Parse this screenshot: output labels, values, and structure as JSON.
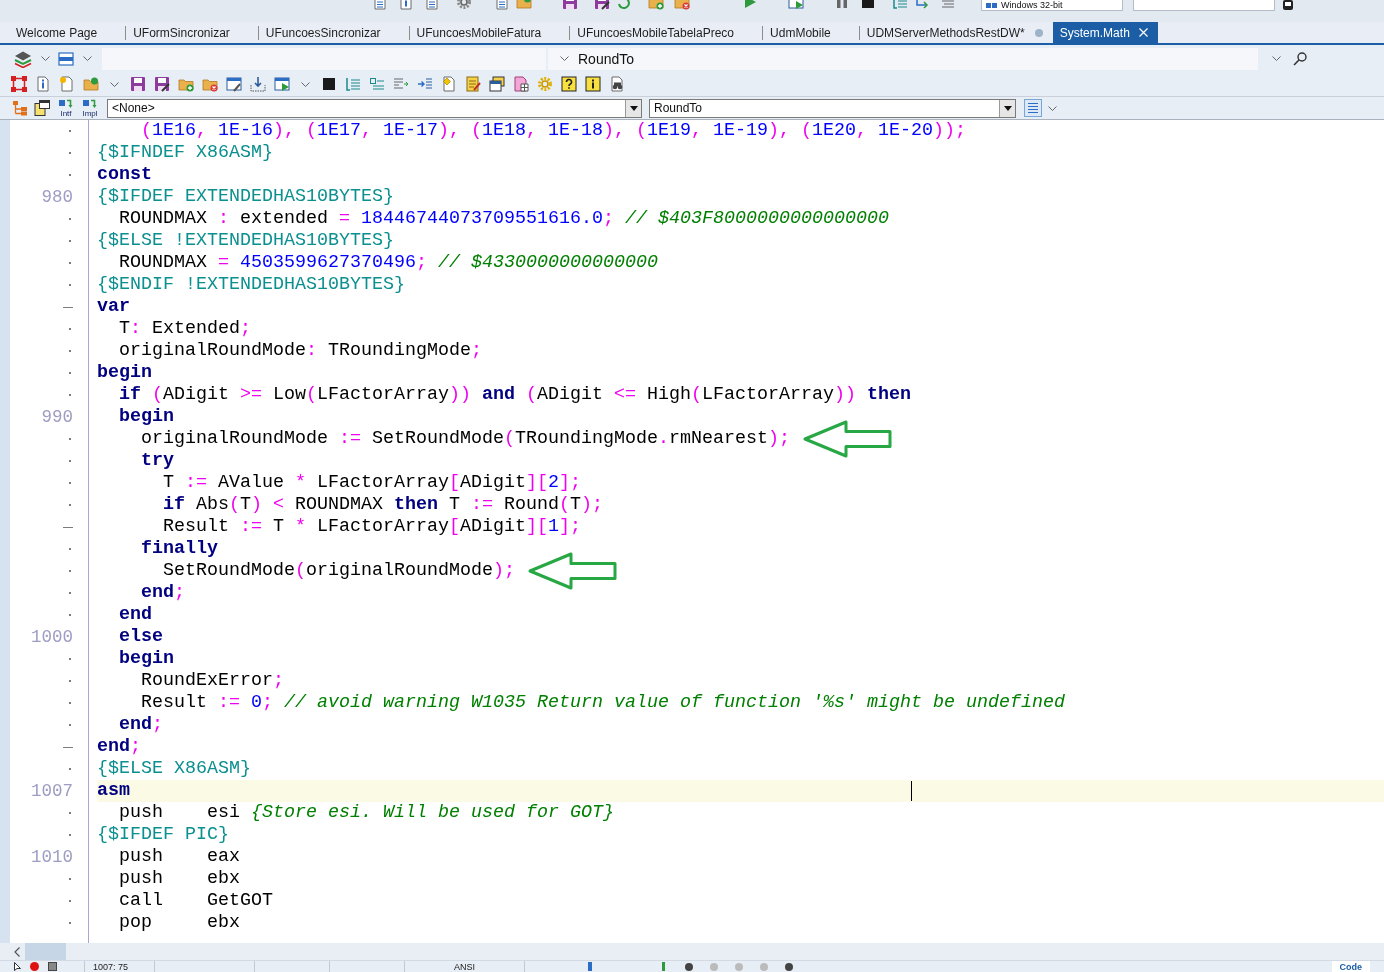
{
  "top_toolbar": {
    "platform": "Windows 32-bit"
  },
  "tabs": [
    {
      "label": "Welcome Page",
      "selected": false,
      "dot": false
    },
    {
      "label": "UFormSincronizar",
      "selected": false,
      "dot": false
    },
    {
      "label": "UFuncoesSincronizar",
      "selected": false,
      "dot": false
    },
    {
      "label": "UFuncoesMobileFatura",
      "selected": false,
      "dot": false
    },
    {
      "label": "UFuncoesMobileTabelaPreco",
      "selected": false,
      "dot": false
    },
    {
      "label": "UdmMobile",
      "selected": false,
      "dot": false
    },
    {
      "label": "UDMServerMethodsRestDW*",
      "selected": false,
      "dot": true
    },
    {
      "label": "System.Math",
      "selected": true,
      "dot": false
    }
  ],
  "navigation_bar": {
    "method": "RoundTo"
  },
  "symbol_bar": {
    "buttons": [
      {
        "label": "Intf"
      },
      {
        "label": "Impl"
      }
    ],
    "scope": "<None>",
    "method": "RoundTo"
  },
  "editor": {
    "lines": [
      {
        "gutter": {
          "kind": "dot"
        },
        "current": false,
        "arrow": false,
        "tokens": [
          {
            "kind": "symbol",
            "text": "    ("
          },
          {
            "kind": "number",
            "text": "1E16"
          },
          {
            "kind": "symbol",
            "text": ","
          },
          {
            "kind": "number",
            "text": " 1E-16"
          },
          {
            "kind": "symbol",
            "text": "), ("
          },
          {
            "kind": "number",
            "text": "1E17"
          },
          {
            "kind": "symbol",
            "text": ","
          },
          {
            "kind": "number",
            "text": " 1E-17"
          },
          {
            "kind": "symbol",
            "text": "), ("
          },
          {
            "kind": "number",
            "text": "1E18"
          },
          {
            "kind": "symbol",
            "text": ","
          },
          {
            "kind": "number",
            "text": " 1E-18"
          },
          {
            "kind": "symbol",
            "text": "), ("
          },
          {
            "kind": "number",
            "text": "1E19"
          },
          {
            "kind": "symbol",
            "text": ","
          },
          {
            "kind": "number",
            "text": " 1E-19"
          },
          {
            "kind": "symbol",
            "text": "), ("
          },
          {
            "kind": "number",
            "text": "1E20"
          },
          {
            "kind": "symbol",
            "text": ","
          },
          {
            "kind": "number",
            "text": " 1E-20"
          },
          {
            "kind": "symbol",
            "text": "));"
          }
        ]
      },
      {
        "gutter": {
          "kind": "dot"
        },
        "current": false,
        "arrow": false,
        "tokens": [
          {
            "kind": "directive",
            "text": "{$IFNDEF X86ASM}"
          }
        ]
      },
      {
        "gutter": {
          "kind": "dot"
        },
        "current": false,
        "arrow": false,
        "tokens": [
          {
            "kind": "keyword",
            "text": "const"
          }
        ]
      },
      {
        "gutter": {
          "kind": "number",
          "text": "980"
        },
        "current": false,
        "arrow": false,
        "tokens": [
          {
            "kind": "directive",
            "text": "{$IFDEF EXTENDEDHAS10BYTES}"
          }
        ]
      },
      {
        "gutter": {
          "kind": "dot"
        },
        "current": false,
        "arrow": false,
        "tokens": [
          {
            "kind": "plain",
            "text": "  ROUNDMAX "
          },
          {
            "kind": "symbol",
            "text": ":"
          },
          {
            "kind": "plain",
            "text": " extended "
          },
          {
            "kind": "symbol",
            "text": "="
          },
          {
            "kind": "number",
            "text": " 18446744073709551616.0"
          },
          {
            "kind": "symbol",
            "text": ";"
          },
          {
            "kind": "comment",
            "text": " // $403F8000000000000000"
          }
        ]
      },
      {
        "gutter": {
          "kind": "dot"
        },
        "current": false,
        "arrow": false,
        "tokens": [
          {
            "kind": "directive",
            "text": "{$ELSE !EXTENDEDHAS10BYTES}"
          }
        ]
      },
      {
        "gutter": {
          "kind": "dot"
        },
        "current": false,
        "arrow": false,
        "tokens": [
          {
            "kind": "plain",
            "text": "  ROUNDMAX "
          },
          {
            "kind": "symbol",
            "text": "="
          },
          {
            "kind": "number",
            "text": " 4503599627370496"
          },
          {
            "kind": "symbol",
            "text": ";"
          },
          {
            "kind": "comment",
            "text": " // $4330000000000000"
          }
        ]
      },
      {
        "gutter": {
          "kind": "dot"
        },
        "current": false,
        "arrow": false,
        "tokens": [
          {
            "kind": "directive",
            "text": "{$ENDIF !EXTENDEDHAS10BYTES}"
          }
        ]
      },
      {
        "gutter": {
          "kind": "tick"
        },
        "current": false,
        "arrow": false,
        "tokens": [
          {
            "kind": "keyword",
            "text": "var"
          }
        ]
      },
      {
        "gutter": {
          "kind": "dot"
        },
        "current": false,
        "arrow": false,
        "tokens": [
          {
            "kind": "plain",
            "text": "  T"
          },
          {
            "kind": "symbol",
            "text": ":"
          },
          {
            "kind": "plain",
            "text": " Extended"
          },
          {
            "kind": "symbol",
            "text": ";"
          }
        ]
      },
      {
        "gutter": {
          "kind": "dot"
        },
        "current": false,
        "arrow": false,
        "tokens": [
          {
            "kind": "plain",
            "text": "  originalRoundMode"
          },
          {
            "kind": "symbol",
            "text": ":"
          },
          {
            "kind": "plain",
            "text": " TRoundingMode"
          },
          {
            "kind": "symbol",
            "text": ";"
          }
        ]
      },
      {
        "gutter": {
          "kind": "dot"
        },
        "current": false,
        "arrow": false,
        "tokens": [
          {
            "kind": "keyword",
            "text": "begin"
          }
        ]
      },
      {
        "gutter": {
          "kind": "dot"
        },
        "current": false,
        "arrow": false,
        "tokens": [
          {
            "kind": "keyword",
            "text": "  if"
          },
          {
            "kind": "symbol",
            "text": " ("
          },
          {
            "kind": "plain",
            "text": "ADigit "
          },
          {
            "kind": "symbol",
            "text": ">="
          },
          {
            "kind": "plain",
            "text": " Low"
          },
          {
            "kind": "symbol",
            "text": "("
          },
          {
            "kind": "plain",
            "text": "LFactorArray"
          },
          {
            "kind": "symbol",
            "text": "))"
          },
          {
            "kind": "keyword",
            "text": " and"
          },
          {
            "kind": "symbol",
            "text": " ("
          },
          {
            "kind": "plain",
            "text": "ADigit "
          },
          {
            "kind": "symbol",
            "text": "<="
          },
          {
            "kind": "plain",
            "text": " High"
          },
          {
            "kind": "symbol",
            "text": "("
          },
          {
            "kind": "plain",
            "text": "LFactorArray"
          },
          {
            "kind": "symbol",
            "text": "))"
          },
          {
            "kind": "keyword",
            "text": " then"
          }
        ]
      },
      {
        "gutter": {
          "kind": "number",
          "text": "990"
        },
        "current": false,
        "arrow": false,
        "tokens": [
          {
            "kind": "keyword",
            "text": "  begin"
          }
        ]
      },
      {
        "gutter": {
          "kind": "dot"
        },
        "current": false,
        "arrow": true,
        "tokens": [
          {
            "kind": "plain",
            "text": "    originalRoundMode "
          },
          {
            "kind": "symbol",
            "text": ":="
          },
          {
            "kind": "plain",
            "text": " SetRoundMode"
          },
          {
            "kind": "symbol",
            "text": "("
          },
          {
            "kind": "plain",
            "text": "TRoundingMode"
          },
          {
            "kind": "symbol",
            "text": "."
          },
          {
            "kind": "plain",
            "text": "rmNearest"
          },
          {
            "kind": "symbol",
            "text": ");"
          }
        ]
      },
      {
        "gutter": {
          "kind": "dot"
        },
        "current": false,
        "arrow": false,
        "tokens": [
          {
            "kind": "keyword",
            "text": "    try"
          }
        ]
      },
      {
        "gutter": {
          "kind": "dot"
        },
        "current": false,
        "arrow": false,
        "tokens": [
          {
            "kind": "plain",
            "text": "      T "
          },
          {
            "kind": "symbol",
            "text": ":="
          },
          {
            "kind": "plain",
            "text": " AValue "
          },
          {
            "kind": "symbol",
            "text": "*"
          },
          {
            "kind": "plain",
            "text": " LFactorArray"
          },
          {
            "kind": "symbol",
            "text": "["
          },
          {
            "kind": "plain",
            "text": "ADigit"
          },
          {
            "kind": "symbol",
            "text": "]["
          },
          {
            "kind": "number",
            "text": "2"
          },
          {
            "kind": "symbol",
            "text": "];"
          }
        ]
      },
      {
        "gutter": {
          "kind": "dot"
        },
        "current": false,
        "arrow": false,
        "tokens": [
          {
            "kind": "keyword",
            "text": "      if"
          },
          {
            "kind": "plain",
            "text": " Abs"
          },
          {
            "kind": "symbol",
            "text": "("
          },
          {
            "kind": "plain",
            "text": "T"
          },
          {
            "kind": "symbol",
            "text": ") <"
          },
          {
            "kind": "plain",
            "text": " ROUNDMAX "
          },
          {
            "kind": "keyword",
            "text": "then"
          },
          {
            "kind": "plain",
            "text": " T "
          },
          {
            "kind": "symbol",
            "text": ":="
          },
          {
            "kind": "plain",
            "text": " Round"
          },
          {
            "kind": "symbol",
            "text": "("
          },
          {
            "kind": "plain",
            "text": "T"
          },
          {
            "kind": "symbol",
            "text": ");"
          }
        ]
      },
      {
        "gutter": {
          "kind": "tick"
        },
        "current": false,
        "arrow": false,
        "tokens": [
          {
            "kind": "plain",
            "text": "      Result "
          },
          {
            "kind": "symbol",
            "text": ":="
          },
          {
            "kind": "plain",
            "text": " T "
          },
          {
            "kind": "symbol",
            "text": "*"
          },
          {
            "kind": "plain",
            "text": " LFactorArray"
          },
          {
            "kind": "symbol",
            "text": "["
          },
          {
            "kind": "plain",
            "text": "ADigit"
          },
          {
            "kind": "symbol",
            "text": "]["
          },
          {
            "kind": "number",
            "text": "1"
          },
          {
            "kind": "symbol",
            "text": "];"
          }
        ]
      },
      {
        "gutter": {
          "kind": "dot"
        },
        "current": false,
        "arrow": false,
        "tokens": [
          {
            "kind": "keyword",
            "text": "    finally"
          }
        ]
      },
      {
        "gutter": {
          "kind": "dot"
        },
        "current": false,
        "arrow": true,
        "tokens": [
          {
            "kind": "plain",
            "text": "      SetRoundMode"
          },
          {
            "kind": "symbol",
            "text": "("
          },
          {
            "kind": "plain",
            "text": "originalRoundMode"
          },
          {
            "kind": "symbol",
            "text": ");"
          }
        ]
      },
      {
        "gutter": {
          "kind": "dot"
        },
        "current": false,
        "arrow": false,
        "tokens": [
          {
            "kind": "keyword",
            "text": "    end"
          },
          {
            "kind": "symbol",
            "text": ";"
          }
        ]
      },
      {
        "gutter": {
          "kind": "dot"
        },
        "current": false,
        "arrow": false,
        "tokens": [
          {
            "kind": "keyword",
            "text": "  end"
          }
        ]
      },
      {
        "gutter": {
          "kind": "number",
          "text": "1000"
        },
        "current": false,
        "arrow": false,
        "tokens": [
          {
            "kind": "keyword",
            "text": "  else"
          }
        ]
      },
      {
        "gutter": {
          "kind": "dot"
        },
        "current": false,
        "arrow": false,
        "tokens": [
          {
            "kind": "keyword",
            "text": "  begin"
          }
        ]
      },
      {
        "gutter": {
          "kind": "dot"
        },
        "current": false,
        "arrow": false,
        "tokens": [
          {
            "kind": "plain",
            "text": "    RoundExError"
          },
          {
            "kind": "symbol",
            "text": ";"
          }
        ]
      },
      {
        "gutter": {
          "kind": "dot"
        },
        "current": false,
        "arrow": false,
        "tokens": [
          {
            "kind": "plain",
            "text": "    Result "
          },
          {
            "kind": "symbol",
            "text": ":="
          },
          {
            "kind": "number",
            "text": " 0"
          },
          {
            "kind": "symbol",
            "text": ";"
          },
          {
            "kind": "comment",
            "text": " // avoid warning W1035 Return value of function '%s' might be undefined"
          }
        ]
      },
      {
        "gutter": {
          "kind": "dot"
        },
        "current": false,
        "arrow": false,
        "tokens": [
          {
            "kind": "keyword",
            "text": "  end"
          },
          {
            "kind": "symbol",
            "text": ";"
          }
        ]
      },
      {
        "gutter": {
          "kind": "tick"
        },
        "current": false,
        "arrow": false,
        "tokens": [
          {
            "kind": "keyword",
            "text": "end"
          },
          {
            "kind": "symbol",
            "text": ";"
          }
        ]
      },
      {
        "gutter": {
          "kind": "dot"
        },
        "current": false,
        "arrow": false,
        "tokens": [
          {
            "kind": "directive",
            "text": "{$ELSE X86ASM}"
          }
        ]
      },
      {
        "gutter": {
          "kind": "number",
          "text": "1007"
        },
        "current": true,
        "arrow": false,
        "tokens": [
          {
            "kind": "keyword",
            "text": "asm"
          }
        ]
      },
      {
        "gutter": {
          "kind": "dot"
        },
        "current": false,
        "arrow": false,
        "tokens": [
          {
            "kind": "plain",
            "text": "  push    esi "
          },
          {
            "kind": "comment",
            "text": "{Store esi. Will be used for GOT}"
          }
        ]
      },
      {
        "gutter": {
          "kind": "dot"
        },
        "current": false,
        "arrow": false,
        "tokens": [
          {
            "kind": "directive",
            "text": "{$IFDEF PIC}"
          }
        ]
      },
      {
        "gutter": {
          "kind": "number",
          "text": "1010"
        },
        "current": false,
        "arrow": false,
        "tokens": [
          {
            "kind": "plain",
            "text": "  push    eax"
          }
        ]
      },
      {
        "gutter": {
          "kind": "dot"
        },
        "current": false,
        "arrow": false,
        "tokens": [
          {
            "kind": "plain",
            "text": "  push    ebx"
          }
        ]
      },
      {
        "gutter": {
          "kind": "dot"
        },
        "current": false,
        "arrow": false,
        "tokens": [
          {
            "kind": "plain",
            "text": "  call    GetGOT"
          }
        ]
      },
      {
        "gutter": {
          "kind": "dot"
        },
        "current": false,
        "arrow": false,
        "tokens": [
          {
            "kind": "plain",
            "text": "  pop     ebx"
          }
        ]
      }
    ]
  },
  "status_bar": {
    "position": "1007: 75",
    "encoding": "ANSI",
    "view_tab": "Code"
  }
}
